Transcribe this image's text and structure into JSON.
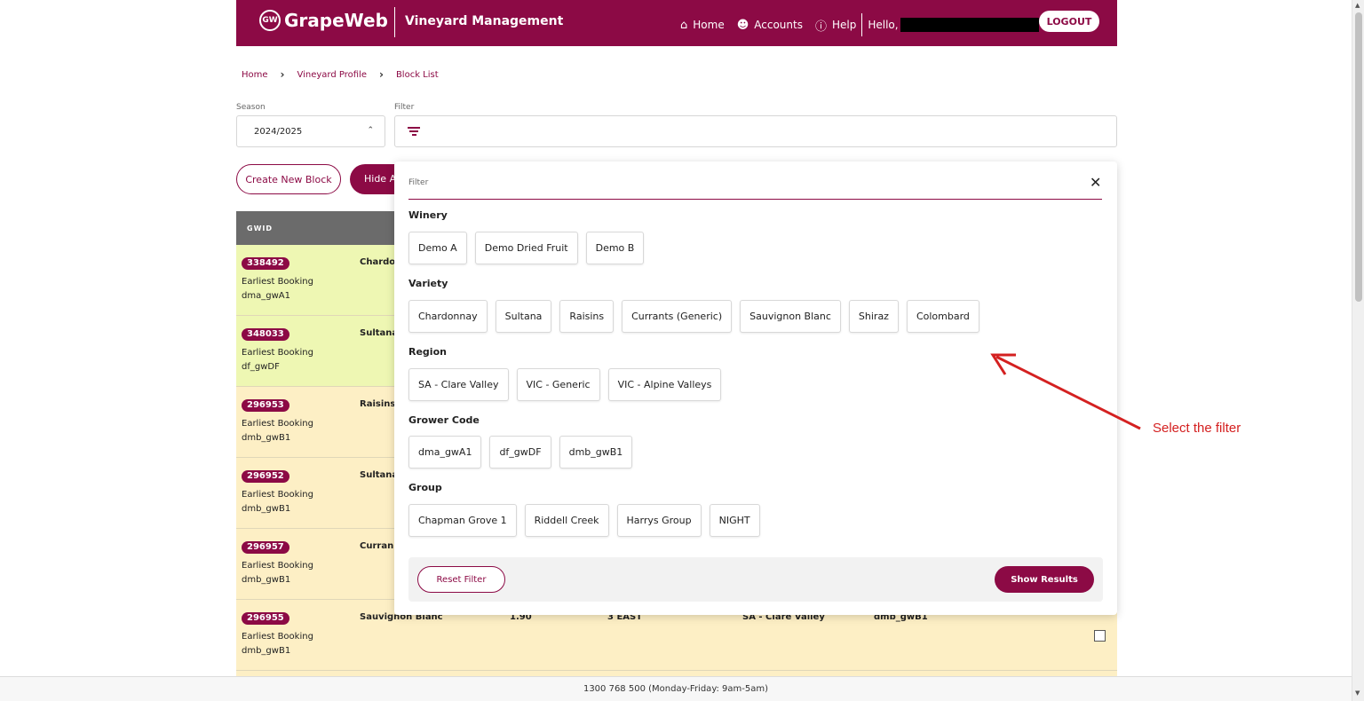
{
  "header": {
    "logo_mark": "GW",
    "logo_text": "GrapeWeb",
    "app_title": "Vineyard Management",
    "nav": [
      {
        "icon": "home-icon",
        "label": "Home"
      },
      {
        "icon": "account-icon",
        "label": "Accounts"
      },
      {
        "icon": "help-icon",
        "label": "Help"
      }
    ],
    "greeting": "Hello,",
    "logout_label": "LOGOUT",
    "brand_color": "#8c0a45"
  },
  "breadcrumb": [
    "Home",
    "Vineyard Profile",
    "Block List"
  ],
  "season": {
    "label": "Season",
    "value": "2024/2025"
  },
  "filter": {
    "label": "Filter"
  },
  "actions": {
    "create_label": "Create New Block",
    "hide_label": "Hide A"
  },
  "table": {
    "header_gwid": "GWID",
    "rows": [
      {
        "gwid": "338492",
        "line1": "Earliest Booking",
        "line2": "dma_gwA1",
        "variety": "Chardo",
        "c3": "",
        "c4": "",
        "c5": "",
        "c6": "",
        "color": "green"
      },
      {
        "gwid": "348033",
        "line1": "Earliest Booking",
        "line2": "df_gwDF",
        "variety": "Sultana",
        "c3": "",
        "c4": "",
        "c5": "",
        "c6": "",
        "color": "green"
      },
      {
        "gwid": "296953",
        "line1": "Earliest Booking",
        "line2": "dmb_gwB1",
        "variety": "Raisins",
        "c3": "",
        "c4": "",
        "c5": "",
        "c6": "",
        "color": "yellow"
      },
      {
        "gwid": "296952",
        "line1": "Earliest Booking",
        "line2": "dmb_gwB1",
        "variety": "Sultana",
        "c3": "",
        "c4": "",
        "c5": "",
        "c6": "",
        "color": "yellow"
      },
      {
        "gwid": "296957",
        "line1": "Earliest Booking",
        "line2": "dmb_gwB1",
        "variety": "Curran",
        "c3": "",
        "c4": "",
        "c5": "",
        "c6": "",
        "color": "yellow"
      },
      {
        "gwid": "296955",
        "line1": "Earliest Booking",
        "line2": "dmb_gwB1",
        "variety": "Sauvignon Blanc",
        "c3": "1.90",
        "c4": "3 EAST",
        "c5": "SA - Clare Valley",
        "c6": "dmb_gwB1",
        "color": "yellow"
      }
    ]
  },
  "panel": {
    "input_label": "Filter",
    "sections": [
      {
        "title": "Winery",
        "chips": [
          "Demo A",
          "Demo Dried Fruit",
          "Demo B"
        ]
      },
      {
        "title": "Variety",
        "chips": [
          "Chardonnay",
          "Sultana",
          "Raisins",
          "Currants (Generic)",
          "Sauvignon Blanc",
          "Shiraz",
          "Colombard"
        ]
      },
      {
        "title": "Region",
        "chips": [
          "SA - Clare Valley",
          "VIC - Generic",
          "VIC - Alpine Valleys"
        ]
      },
      {
        "title": "Grower Code",
        "chips": [
          "dma_gwA1",
          "df_gwDF",
          "dmb_gwB1"
        ]
      },
      {
        "title": "Group",
        "chips": [
          "Chapman Grove 1",
          "Riddell Creek",
          "Harrys Group",
          "NIGHT"
        ]
      }
    ],
    "reset_label": "Reset Filter",
    "show_label": "Show Results"
  },
  "annotation": {
    "text": "Select the filter",
    "color": "#d42020"
  },
  "footer": {
    "text": "1300 768 500 (Monday-Friday: 9am-5am)"
  }
}
